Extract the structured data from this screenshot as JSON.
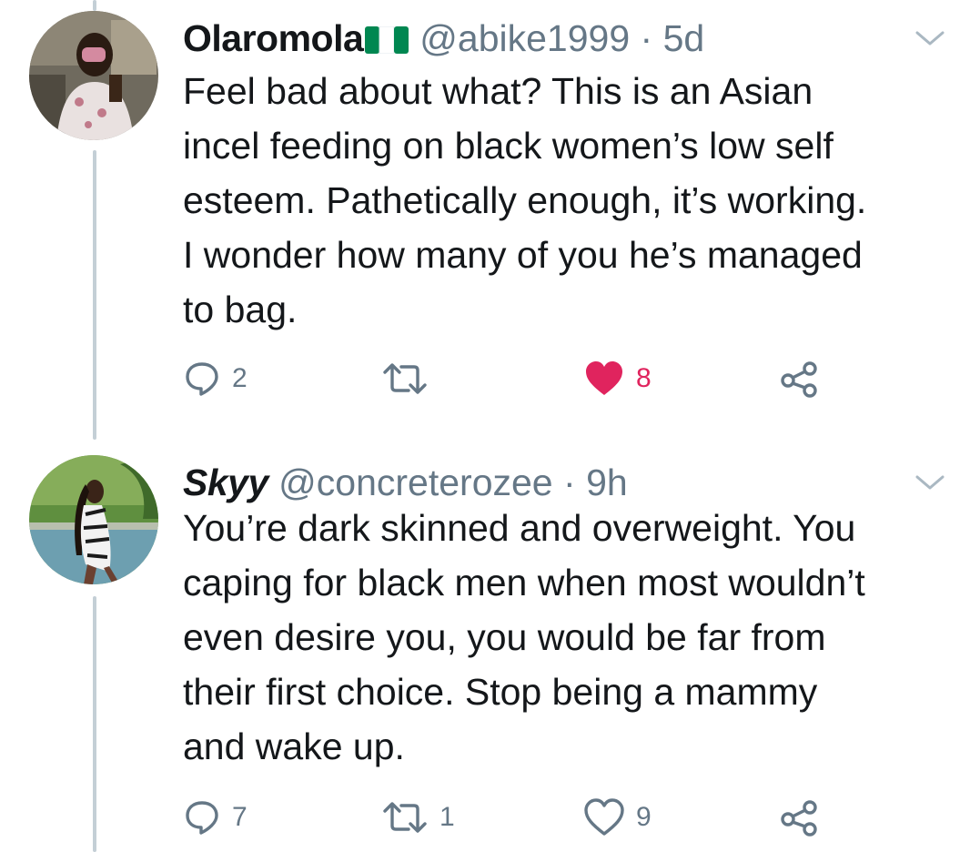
{
  "tweets": [
    {
      "name": "Olaromola",
      "handle": "@abike1999",
      "separator": "·",
      "time": "5d",
      "text": "Feel bad about what? This is an Asian\nincel feeding on black women’s low self\nesteem. Pathetically enough, it’s working.\nI wonder how many of you he’s managed\nto bag.",
      "replies": "2",
      "retweets": "",
      "likes": "8",
      "liked": true,
      "flag_icon": "nigeria-flag-icon",
      "colors": {
        "like_active": "#e0245e",
        "flag_green": "#008751"
      }
    },
    {
      "name": "Skyy",
      "handle": "@concreterozee",
      "separator": "·",
      "time": "9h",
      "text": "You’re dark skinned and overweight. You\ncaping for black men when most wouldn’t\neven desire you, you would be far from\ntheir first choice. Stop being a mammy\nand wake up.",
      "replies": "7",
      "retweets": "1",
      "likes": "9",
      "liked": false
    }
  ],
  "icons": {
    "reply": "reply-icon",
    "retweet": "retweet-icon",
    "like": "heart-icon",
    "share": "share-icon",
    "menu": "chevron-down-icon"
  },
  "colors": {
    "text": "#14171a",
    "secondary": "#657786",
    "thread_line": "#c4cfd6",
    "background": "#ffffff"
  }
}
